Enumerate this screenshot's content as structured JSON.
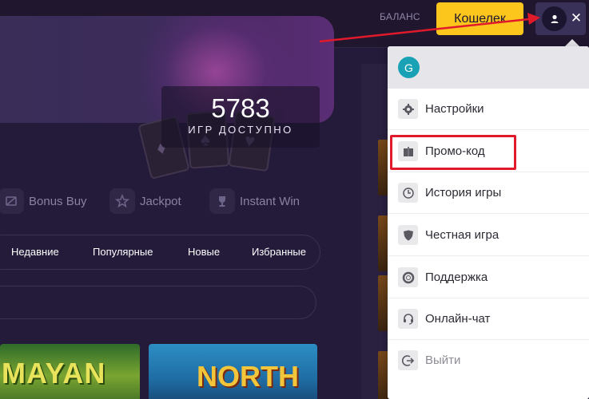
{
  "header": {
    "balance_label": "БАЛАНС",
    "wallet_label": "Кошелек",
    "close_glyph": "✕"
  },
  "banner": {
    "count": "5783",
    "count_label": "ИГР ДОСТУПНО"
  },
  "categories": [
    {
      "label": "Bonus Buy",
      "icon": "bonus-buy-icon"
    },
    {
      "label": "Jackpot",
      "icon": "star-icon"
    },
    {
      "label": "Instant Win",
      "icon": "trophy-icon"
    }
  ],
  "filters": [
    "Недавние",
    "Популярные",
    "Новые",
    "Избранные"
  ],
  "games": [
    {
      "title": "MAYAN"
    },
    {
      "title": "NORTH"
    }
  ],
  "menu": {
    "user_initial": "G",
    "items": [
      {
        "label": "Настройки",
        "icon": "gear-icon"
      },
      {
        "label": "Промо-код",
        "icon": "gift-icon"
      },
      {
        "label": "История игры",
        "icon": "clock-icon"
      },
      {
        "label": "Честная игра",
        "icon": "shield-icon"
      },
      {
        "label": "Поддержка",
        "icon": "lifebuoy-icon"
      },
      {
        "label": "Онлайн-чат",
        "icon": "headset-icon"
      },
      {
        "label": "Выйти",
        "icon": "logout-icon"
      }
    ]
  },
  "colors": {
    "accent": "#fcc61c",
    "highlight": "#e0192b",
    "avatar": "#19a1b5"
  }
}
